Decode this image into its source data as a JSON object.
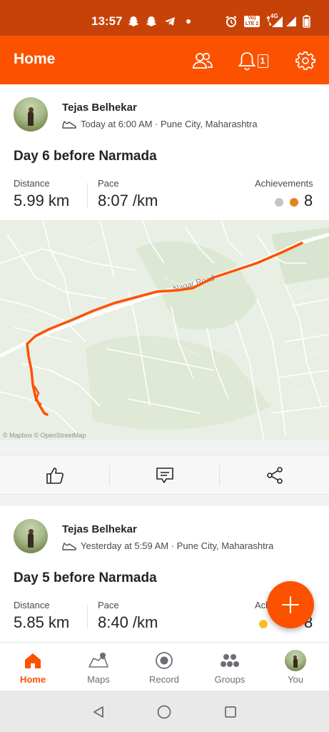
{
  "status_bar": {
    "time": "13:57",
    "icons": [
      "snapchat-icon",
      "snapchat-icon",
      "telegram-icon",
      "dot-icon",
      "alarm-icon",
      "volte-icon",
      "4g-icon",
      "signal-icon",
      "signal-icon",
      "battery-icon"
    ],
    "volte_label": "Vo) LTE 2",
    "network_label": "4G"
  },
  "header": {
    "title": "Home",
    "notification_count": "1",
    "icons": [
      "people-icon",
      "bell-icon",
      "settings-gear-icon"
    ]
  },
  "feed": [
    {
      "athlete": "Tejas Belhekar",
      "activity_icon": "shoe-icon",
      "meta": "Today at 6:00 AM · Pune City, Maharashtra",
      "title": "Day 6 before Narmada",
      "stats": {
        "distance_label": "Distance",
        "distance_value": "5.99 km",
        "pace_label": "Pace",
        "pace_value": "8:07 /km",
        "achievements_label": "Achievements",
        "achievements_count": "8"
      },
      "map": {
        "road_label": "Nagar Road",
        "credit": "© Mapbox © OpenStreetMap",
        "route_color": "#fc5200"
      }
    },
    {
      "athlete": "Tejas Belhekar",
      "activity_icon": "shoe-icon",
      "meta": "Yesterday at 5:59 AM · Pune City, Maharashtra",
      "title": "Day 5 before Narmada",
      "stats": {
        "distance_label": "Distance",
        "distance_value": "5.85 km",
        "pace_label": "Pace",
        "pace_value": "8:40 /km",
        "achievements_label": "Ach",
        "achievements_count": "8"
      }
    }
  ],
  "actions": {
    "icons": [
      "thumbs-up-icon",
      "comment-icon",
      "share-icon"
    ]
  },
  "fab": {
    "icon": "plus-icon"
  },
  "bottom_nav": [
    {
      "label": "Home",
      "icon": "home-icon",
      "active": true
    },
    {
      "label": "Maps",
      "icon": "map-pin-icon",
      "active": false
    },
    {
      "label": "Record",
      "icon": "record-icon",
      "active": false
    },
    {
      "label": "Groups",
      "icon": "groups-icon",
      "active": false
    },
    {
      "label": "You",
      "icon": "avatar",
      "active": false
    }
  ],
  "system_nav": {
    "icons": [
      "back-icon",
      "home-circle-icon",
      "recents-icon"
    ]
  },
  "colors": {
    "brand": "#fc5200",
    "status_bar": "#c74209",
    "medal_silver": "#c4c4c8",
    "medal_bronze": "#e0851e",
    "medal_gold": "#f5c025"
  }
}
